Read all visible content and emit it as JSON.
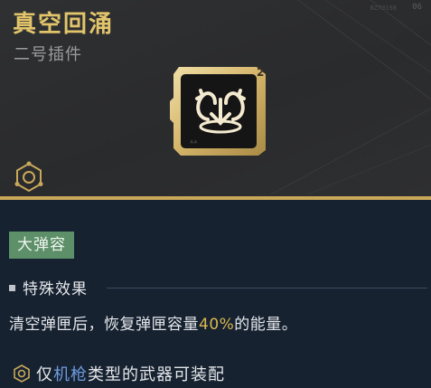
{
  "item": {
    "name": "真空回涌",
    "slot": "二号插件",
    "rank_badge": "2",
    "icon": "vacuum-surge-arrows-icon"
  },
  "header_marks": {
    "code": "NZT0198",
    "number": "06"
  },
  "tag": {
    "label": "大弹容"
  },
  "effect": {
    "section_title": "特殊效果",
    "text_before": "清空弹匣后，恢复弹匣容量",
    "value": "40%",
    "text_after": "的能量。"
  },
  "restriction": {
    "prefix": "仅",
    "weapon_type": "机枪",
    "suffix": "类型的武器可装配"
  },
  "colors": {
    "title_gold": "#e2c56b",
    "gold_line": "#c9a85a",
    "tag_green": "#5d8f69",
    "highlight": "#d9b84f",
    "weapon_blue": "#6f9ce0",
    "panel_bg": "#172231"
  }
}
